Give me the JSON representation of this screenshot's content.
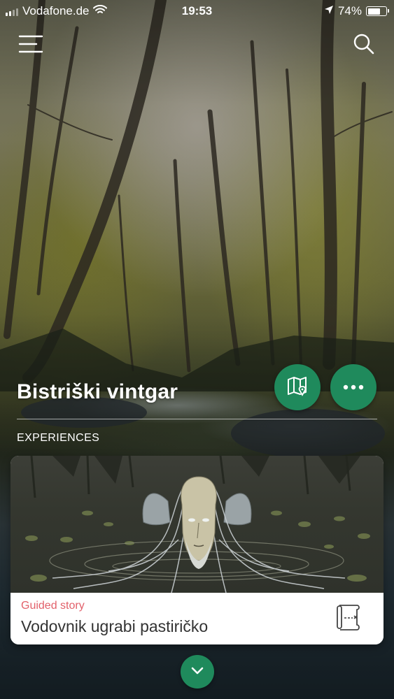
{
  "status_bar": {
    "carrier": "Vodafone.de",
    "time": "19:53",
    "battery_percent": "74%",
    "battery_level": 0.74
  },
  "header": {
    "menu_icon": "hamburger-menu-icon",
    "search_icon": "search-icon"
  },
  "place": {
    "title": "Bistriški vintgar",
    "map_icon": "map-pin-icon",
    "more_icon": "ellipsis-icon"
  },
  "section": {
    "label": "EXPERIENCES"
  },
  "experiences": [
    {
      "tag": "Guided story",
      "title": "Vodovnik ugrabi pastiričko",
      "icon": "scroll-map-icon"
    }
  ],
  "footer": {
    "expand_icon": "chevron-down-icon"
  },
  "colors": {
    "accent": "#1f8a5c",
    "tag": "#e2606a",
    "title_text": "#333333"
  }
}
